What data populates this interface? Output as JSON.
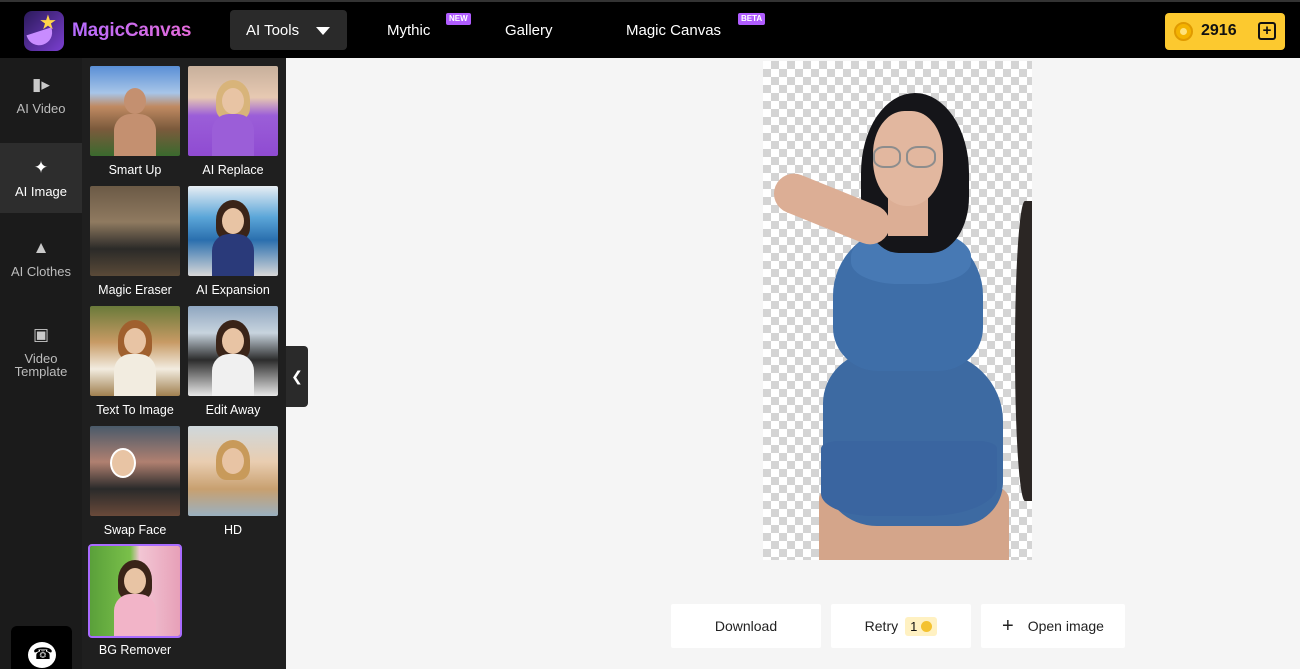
{
  "header": {
    "brand": "MagicCanvas",
    "tools_dropdown": "AI Tools",
    "nav": [
      {
        "label": "Mythic",
        "badge": "NEW"
      },
      {
        "label": "Gallery",
        "badge": ""
      },
      {
        "label": "Magic Canvas",
        "badge": "BETA"
      }
    ],
    "credits": "2916",
    "credits_plus": "+"
  },
  "rail": {
    "items": [
      {
        "label": "AI Video",
        "icon": "video-camera-icon"
      },
      {
        "label": "AI Image",
        "icon": "sparkle-icon",
        "active": true
      },
      {
        "label": "AI Clothes",
        "icon": "dress-icon"
      },
      {
        "label": "Video Template",
        "icon": "template-icon"
      }
    ],
    "help_icon": "chat-phone-icon"
  },
  "tools": [
    {
      "label": "Smart Up"
    },
    {
      "label": "AI Replace"
    },
    {
      "label": "Magic Eraser"
    },
    {
      "label": "AI Expansion"
    },
    {
      "label": "Text To Image"
    },
    {
      "label": "Edit Away"
    },
    {
      "label": "Swap Face"
    },
    {
      "label": "HD"
    },
    {
      "label": "BG Remover",
      "selected": true
    }
  ],
  "collapse_icon": "chevron-left-icon",
  "actions": {
    "download": "Download",
    "retry": "Retry",
    "retry_cost": "1",
    "open_image": "Open image",
    "open_icon": "plus-icon"
  },
  "colors": {
    "accent": "#a96bff",
    "credits_bg": "#fcc92f"
  }
}
